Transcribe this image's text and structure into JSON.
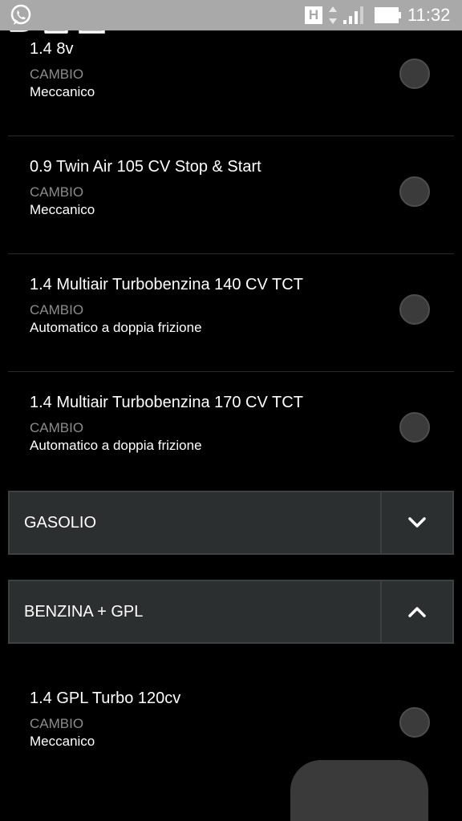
{
  "status_bar": {
    "time": "11:32",
    "h_indicator": "H",
    "icons": [
      "whatsapp-icon",
      "data-arrows-icon",
      "signal-icon",
      "battery-icon"
    ]
  },
  "engines_top": [
    {
      "title": "1.4 8v",
      "sub": "CAMBIO",
      "val": "Meccanico"
    },
    {
      "title": "0.9 Twin Air 105 CV Stop & Start",
      "sub": "CAMBIO",
      "val": "Meccanico"
    },
    {
      "title": "1.4 Multiair Turbobenzina 140 CV TCT",
      "sub": "CAMBIO",
      "val": "Automatico a doppia frizione"
    },
    {
      "title": "1.4 Multiair Turbobenzina 170 CV TCT",
      "sub": "CAMBIO",
      "val": "Automatico a doppia frizione"
    }
  ],
  "sections": [
    {
      "label": "GASOLIO",
      "expanded": false,
      "icon": "chevron-down-icon"
    },
    {
      "label": "BENZINA + GPL",
      "expanded": true,
      "icon": "chevron-up-icon"
    }
  ],
  "engines_gpl": [
    {
      "title": "1.4 GPL Turbo 120cv",
      "sub": "CAMBIO",
      "val": "Meccanico"
    }
  ],
  "nav": {
    "icons": [
      "back-icon",
      "home-icon",
      "recents-icon"
    ]
  },
  "colors": {
    "statusbar": "#a9a9a9",
    "section_bg": "#2c2f30",
    "radio": "#3b3b3b"
  }
}
